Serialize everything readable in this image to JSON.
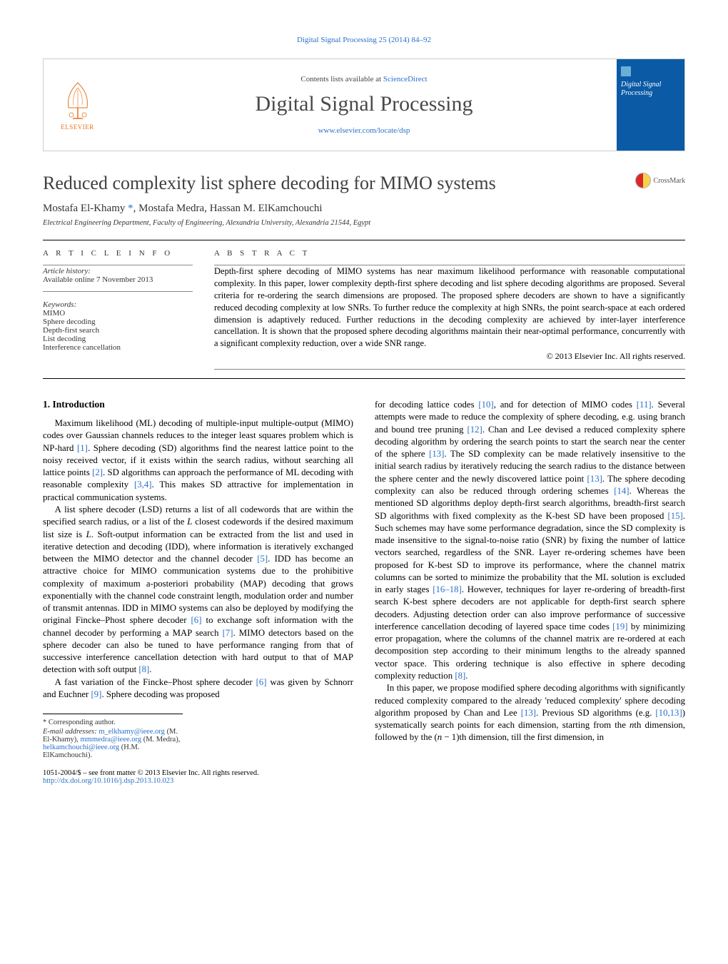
{
  "journal_ref": "Digital Signal Processing 25 (2014) 84–92",
  "masthead": {
    "contents_prefix": "Contents lists available at ",
    "contents_link": "ScienceDirect",
    "journal_title": "Digital Signal Processing",
    "locate_url": "www.elsevier.com/locate/dsp",
    "publisher": "ELSEVIER",
    "cover_title": "Digital Signal Processing"
  },
  "article": {
    "title": "Reduced complexity list sphere decoding for MIMO systems",
    "crossmark_label": "CrossMark",
    "authors_html": "Mostafa El-Khamy *, Mostafa Medra, Hassan M. ElKamchouchi",
    "authors": [
      {
        "name": "Mostafa El-Khamy",
        "corresponding": true
      },
      {
        "name": "Mostafa Medra",
        "corresponding": false
      },
      {
        "name": "Hassan M. ElKamchouchi",
        "corresponding": false
      }
    ],
    "affiliation": "Electrical Engineering Department, Faculty of Engineering, Alexandria University, Alexandria 21544, Egypt"
  },
  "info": {
    "heading": "A R T I C L E   I N F O",
    "history_title": "Article history:",
    "history_line": "Available online 7 November 2013",
    "keywords_title": "Keywords:",
    "keywords": [
      "MIMO",
      "Sphere decoding",
      "Depth-first search",
      "List decoding",
      "Interference cancellation"
    ]
  },
  "abstract": {
    "heading": "A B S T R A C T",
    "text": "Depth-first sphere decoding of MIMO systems has near maximum likelihood performance with reasonable computational complexity. In this paper, lower complexity depth-first sphere decoding and list sphere decoding algorithms are proposed. Several criteria for re-ordering the search dimensions are proposed. The proposed sphere decoders are shown to have a significantly reduced decoding complexity at low SNRs. To further reduce the complexity at high SNRs, the point search-space at each ordered dimension is adaptively reduced. Further reductions in the decoding complexity are achieved by inter-layer interference cancellation. It is shown that the proposed sphere decoding algorithms maintain their near-optimal performance, concurrently with a significant complexity reduction, over a wide SNR range.",
    "copyright": "© 2013 Elsevier Inc. All rights reserved."
  },
  "body": {
    "section_1_heading": "1. Introduction",
    "col1_p1": "Maximum likelihood (ML) decoding of multiple-input multiple-output (MIMO) codes over Gaussian channels reduces to the integer least squares problem which is NP-hard [1]. Sphere decoding (SD) algorithms find the nearest lattice point to the noisy received vector, if it exists within the search radius, without searching all lattice points [2]. SD algorithms can approach the performance of ML decoding with reasonable complexity [3,4]. This makes SD attractive for implementation in practical communication systems.",
    "col1_p2": "A list sphere decoder (LSD) returns a list of all codewords that are within the specified search radius, or a list of the L closest codewords if the desired maximum list size is L. Soft-output information can be extracted from the list and used in iterative detection and decoding (IDD), where information is iteratively exchanged between the MIMO detector and the channel decoder [5]. IDD has become an attractive choice for MIMO communication systems due to the prohibitive complexity of maximum a-posteriori probability (MAP) decoding that grows exponentially with the channel code constraint length, modulation order and number of transmit antennas. IDD in MIMO systems can also be deployed by modifying the original Fincke–Phost sphere decoder [6] to exchange soft information with the channel decoder by performing a MAP search [7]. MIMO detectors based on the sphere decoder can also be tuned to have performance ranging from that of successive interference cancellation detection with hard output to that of MAP detection with soft output [8].",
    "col1_p3": "A fast variation of the Fincke–Phost sphere decoder [6] was given by Schnorr and Euchner [9]. Sphere decoding was proposed",
    "col2_p1": "for decoding lattice codes [10], and for detection of MIMO codes [11]. Several attempts were made to reduce the complexity of sphere decoding, e.g. using branch and bound tree pruning [12]. Chan and Lee devised a reduced complexity sphere decoding algorithm by ordering the search points to start the search near the center of the sphere [13]. The SD complexity can be made relatively insensitive to the initial search radius by iteratively reducing the search radius to the distance between the sphere center and the newly discovered lattice point [13]. The sphere decoding complexity can also be reduced through ordering schemes [14]. Whereas the mentioned SD algorithms deploy depth-first search algorithms, breadth-first search SD algorithms with fixed complexity as the K-best SD have been proposed [15]. Such schemes may have some performance degradation, since the SD complexity is made insensitive to the signal-to-noise ratio (SNR) by fixing the number of lattice vectors searched, regardless of the SNR. Layer re-ordering schemes have been proposed for K-best SD to improve its performance, where the channel matrix columns can be sorted to minimize the probability that the ML solution is excluded in early stages [16–18]. However, techniques for layer re-ordering of breadth-first search K-best sphere decoders are not applicable for depth-first search sphere decoders. Adjusting detection order can also improve performance of successive interference cancellation decoding of layered space time codes [19] by minimizing error propagation, where the columns of the channel matrix are re-ordered at each decomposition step according to their minimum lengths to the already spanned vector space. This ordering technique is also effective in sphere decoding complexity reduction [8].",
    "col2_p2": "In this paper, we propose modified sphere decoding algorithms with significantly reduced complexity compared to the already 'reduced complexity' sphere decoding algorithm proposed by Chan and Lee [13]. Previous SD algorithms (e.g. [10,13]) systematically search points for each dimension, starting from the nth dimension, followed by the (n − 1)th dimension, till the first dimension, in"
  },
  "refs_inline": {
    "r1": "[1]",
    "r2": "[2]",
    "r34": "[3,4]",
    "r5": "[5]",
    "r6": "[6]",
    "r7": "[7]",
    "r8": "[8]",
    "r9": "[9]",
    "r10": "[10]",
    "r11": "[11]",
    "r12": "[12]",
    "r13": "[13]",
    "r14": "[14]",
    "r15": "[15]",
    "r1618": "[16–18]",
    "r19": "[19]",
    "r1013": "[10,13]"
  },
  "footnotes": {
    "corr": "* Corresponding author.",
    "email_label": "E-mail addresses:",
    "emails": [
      {
        "addr": "m_elkhamy@ieee.org",
        "owner": "(M. El-Khamy)"
      },
      {
        "addr": "mmmedra@ieee.org",
        "owner": "(M. Medra)"
      },
      {
        "addr": "helkamchouchi@ieee.org",
        "owner": "(H.M. ElKamchouchi)"
      }
    ]
  },
  "bottom": {
    "issn_line": "1051-2004/$ – see front matter © 2013 Elsevier Inc. All rights reserved.",
    "doi": "http://dx.doi.org/10.1016/j.dsp.2013.10.023"
  }
}
